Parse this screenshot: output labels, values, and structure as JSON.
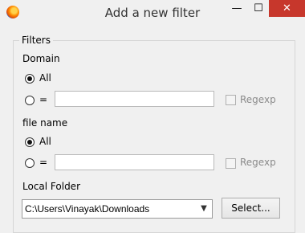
{
  "window": {
    "title": "Add a new filter",
    "controls": {
      "minimize": "—",
      "maximize": "☐",
      "close": "✕"
    }
  },
  "filters": {
    "group_label": "Filters",
    "domain": {
      "label": "Domain",
      "option_all": "All",
      "option_equals": "=",
      "selected": "All",
      "input_value": "",
      "regexp_label": "Regexp",
      "regexp_checked": false,
      "regexp_enabled": false
    },
    "file_name": {
      "label": "file name",
      "option_all": "All",
      "option_equals": "=",
      "selected": "All",
      "input_value": "",
      "regexp_label": "Regexp",
      "regexp_checked": false,
      "regexp_enabled": false
    }
  },
  "local_folder": {
    "label": "Local Folder",
    "value": "C:\\Users\\Vinayak\\Downloads",
    "select_button": "Select..."
  },
  "icons": {
    "app": "firefox-icon",
    "dropdown": "chevron-down-icon"
  }
}
